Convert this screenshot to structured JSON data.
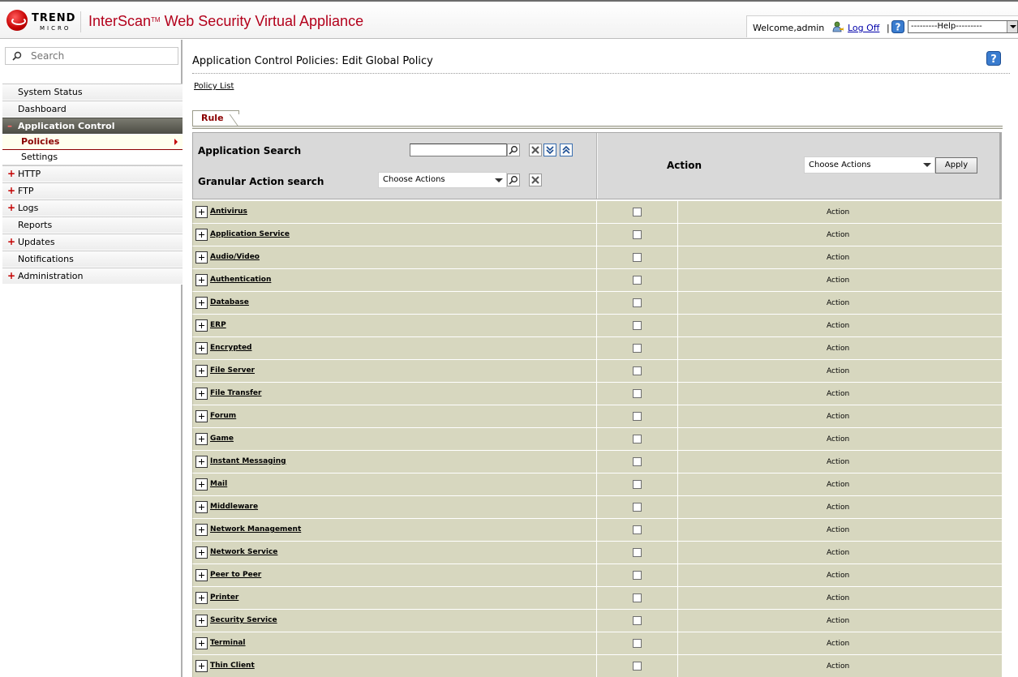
{
  "header": {
    "logo_trend": "TREND",
    "logo_micro": "MICRO",
    "product_name": "InterScan",
    "trademark": "TM",
    "product_suffix": " Web Security Virtual Appliance",
    "welcome": "Welcome,admin",
    "logoff": "Log Off",
    "separator": "|",
    "help_option": "---------Help---------"
  },
  "sidebar": {
    "search_placeholder": "Search",
    "items": [
      {
        "label": "System Status",
        "expandable": false
      },
      {
        "label": "Dashboard",
        "expandable": false
      },
      {
        "label": "Application Control",
        "expandable": true,
        "expanded": true,
        "active": true
      },
      {
        "label": "Policies",
        "sub": true,
        "selected": true
      },
      {
        "label": "Settings",
        "sub": true
      },
      {
        "label": "HTTP",
        "expandable": true
      },
      {
        "label": "FTP",
        "expandable": true
      },
      {
        "label": "Logs",
        "expandable": true
      },
      {
        "label": "Reports",
        "expandable": false
      },
      {
        "label": "Updates",
        "expandable": true
      },
      {
        "label": "Notifications",
        "expandable": false
      },
      {
        "label": "Administration",
        "expandable": true
      }
    ]
  },
  "main": {
    "title": "Application Control Policies: Edit Global Policy",
    "breadcrumb_link": "Policy List",
    "tab_rule": "Rule",
    "filter": {
      "app_search_label": "Application Search",
      "app_search_value": "",
      "granular_label": "Granular Action search",
      "granular_selected": "Choose Actions",
      "action_header": "Action",
      "choose_actions": "Choose Actions",
      "apply_label": "Apply"
    },
    "rows": [
      {
        "category": "Antivirus",
        "action": "Action"
      },
      {
        "category": "Application Service",
        "action": "Action"
      },
      {
        "category": "Audio/Video",
        "action": "Action"
      },
      {
        "category": "Authentication",
        "action": "Action"
      },
      {
        "category": "Database",
        "action": "Action"
      },
      {
        "category": "ERP",
        "action": "Action"
      },
      {
        "category": "Encrypted",
        "action": "Action"
      },
      {
        "category": "File Server",
        "action": "Action"
      },
      {
        "category": "File Transfer",
        "action": "Action"
      },
      {
        "category": "Forum",
        "action": "Action"
      },
      {
        "category": "Game",
        "action": "Action"
      },
      {
        "category": "Instant Messaging",
        "action": "Action"
      },
      {
        "category": "Mail",
        "action": "Action"
      },
      {
        "category": "Middleware",
        "action": "Action"
      },
      {
        "category": "Network Management",
        "action": "Action"
      },
      {
        "category": "Network Service",
        "action": "Action"
      },
      {
        "category": "Peer to Peer",
        "action": "Action"
      },
      {
        "category": "Printer",
        "action": "Action"
      },
      {
        "category": "Security Service",
        "action": "Action"
      },
      {
        "category": "Terminal",
        "action": "Action"
      },
      {
        "category": "Thin Client",
        "action": "Action"
      }
    ]
  },
  "colors": {
    "brand_red": "#b3001b",
    "nav_active_bg": "#5c5c54",
    "row_bg": "#d7d7bf",
    "filter_bg": "#d9d9d9",
    "link_blue": "#0000aa"
  },
  "icons": [
    "trend-micro-logo-icon",
    "logoff-user-icon",
    "help-icon",
    "search-icon",
    "clear-icon",
    "expand-all-icon",
    "collapse-all-icon",
    "expand-row-icon",
    "dropdown-arrow-icon"
  ]
}
